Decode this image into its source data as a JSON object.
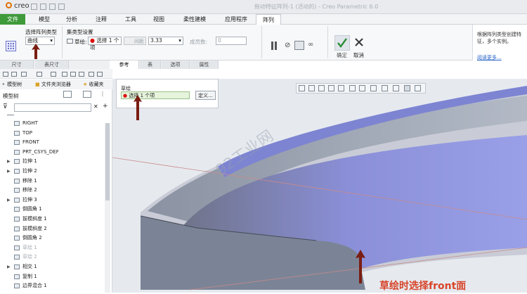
{
  "app": {
    "logo": "creo",
    "window_title": "拖动特征阵列-1 (活动的) - Creo Parametric 6.0"
  },
  "menu": [
    "文件",
    "模型",
    "分析",
    "注释",
    "工具",
    "视图",
    "柔性建模",
    "应用程序",
    "阵列"
  ],
  "ribbon": {
    "type_group_label": "选择阵列类型",
    "type_value": "曲线",
    "set_group_label": "集类型设置",
    "sketch_label": "草绘:",
    "sketch_value": "选择 1 个项",
    "spacing_label": "间距",
    "spacing_value": "3.33",
    "count_label": "成员数:",
    "count_value": "0",
    "ok_label": "确定",
    "cancel_label": "取消",
    "help_text": "根据阵列类型创建特征，多个实例。",
    "help_link": "阅读更多..."
  },
  "tabs": [
    "尺寸",
    "表尺寸",
    "参考",
    "表",
    "选项",
    "属性"
  ],
  "popup": {
    "section": "草绘",
    "select_text": "选择 1 个项",
    "define_button": "定义..."
  },
  "treetabs": [
    "模型树",
    "文件夹浏览器",
    "收藏夹"
  ],
  "tree_title": "模型树",
  "tree_items": [
    {
      "label": "RIGHT",
      "icon": "datum-plane-icon",
      "exp": "",
      "dim": false
    },
    {
      "label": "TOP",
      "icon": "datum-plane-icon",
      "exp": "",
      "dim": false
    },
    {
      "label": "FRONT",
      "icon": "datum-plane-icon",
      "exp": "",
      "dim": false
    },
    {
      "label": "PRT_CSYS_DEF",
      "icon": "csys-icon",
      "exp": "",
      "dim": false
    },
    {
      "label": "拉伸 1",
      "icon": "extrude-icon",
      "exp": "▶",
      "dim": false
    },
    {
      "label": "拉伸 2",
      "icon": "extrude-icon",
      "exp": "▶",
      "dim": false
    },
    {
      "label": "移除 1",
      "icon": "remove-icon",
      "exp": "",
      "dim": false
    },
    {
      "label": "移除 2",
      "icon": "remove-icon",
      "exp": "",
      "dim": false
    },
    {
      "label": "拉伸 3",
      "icon": "extrude-icon",
      "exp": "▶",
      "dim": false
    },
    {
      "label": "倒圆角 1",
      "icon": "round-icon",
      "exp": "",
      "dim": false
    },
    {
      "label": "拔模斜度 1",
      "icon": "draft-icon",
      "exp": "",
      "dim": false
    },
    {
      "label": "拔模斜度 2",
      "icon": "draft-icon",
      "exp": "",
      "dim": false
    },
    {
      "label": "倒圆角 2",
      "icon": "round-icon",
      "exp": "",
      "dim": false
    },
    {
      "label": "草绘 1",
      "icon": "sketch-icon",
      "exp": "",
      "dim": true
    },
    {
      "label": "草绘 2",
      "icon": "sketch-icon",
      "exp": "",
      "dim": true
    },
    {
      "label": "相交 1",
      "icon": "intersect-icon",
      "exp": "▶",
      "dim": false
    },
    {
      "label": "复制 1",
      "icon": "copy-icon",
      "exp": "",
      "dim": false
    },
    {
      "label": "边界混合 1",
      "icon": "boundary-blend-icon",
      "exp": "",
      "dim": false
    }
  ],
  "watermark": "92工业网",
  "annotation": "草绘时选择front面",
  "colors": {
    "accent": "#3f9a3a",
    "arrow": "#7a1d12",
    "annotation": "#d8442a",
    "surface": "#8088e0"
  }
}
